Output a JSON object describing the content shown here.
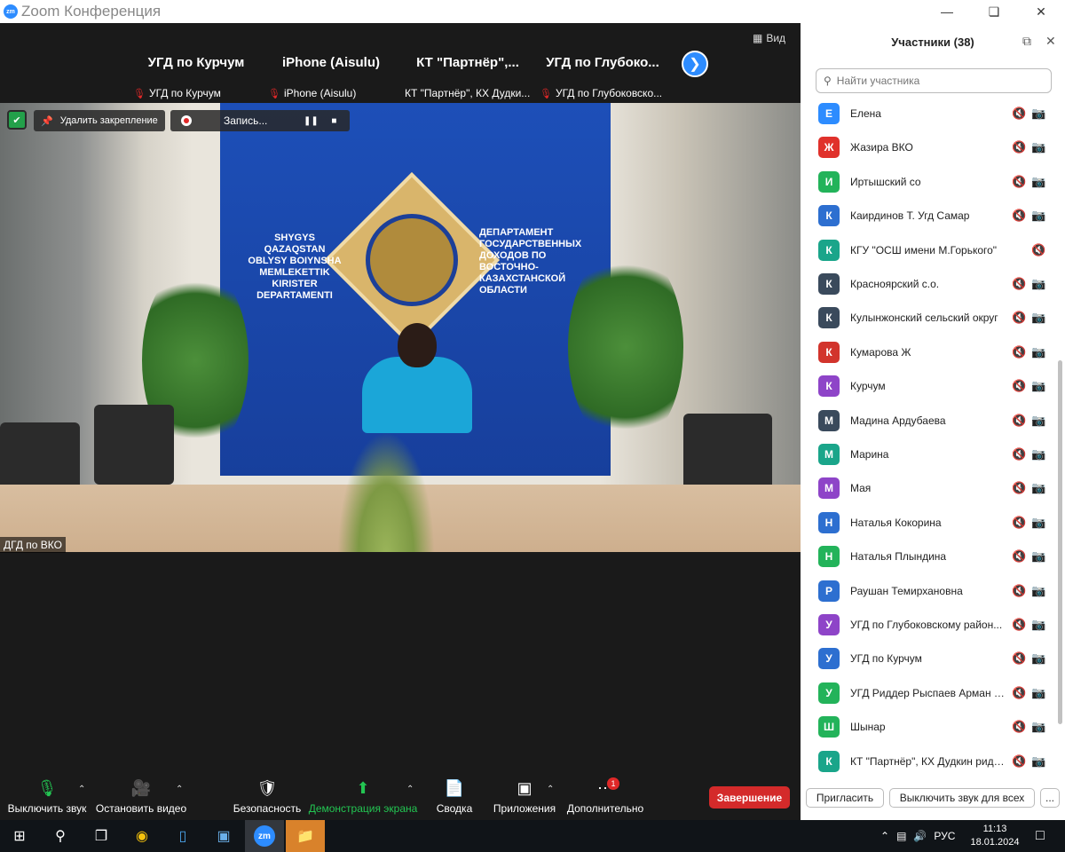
{
  "window": {
    "title": "Zoom Конференция",
    "logo": "zm"
  },
  "thumbnails": [
    {
      "name": "УГД по Курчум",
      "label": "УГД по Курчум"
    },
    {
      "name": "iPhone (Aisulu)",
      "label": "iPhone (Aisulu)"
    },
    {
      "name": "КТ  \"Партнёр\",...",
      "label": "КТ \"Партнёр\", КХ Дудки..."
    },
    {
      "name": "УГД  по  Глубоко...",
      "label": "УГД по Глубоковско..."
    }
  ],
  "view_label": "Вид",
  "video": {
    "unpin_label": "Удалить закрепление",
    "recording_label": "Запись...",
    "speaker_name": "ДГД по ВКО",
    "wall_left": "SHYGYS QAZAQSTAN\nOBLYSY BOIYNSHA\nMEMLEKETTIK\nKIRISTER\nDEPARTAMENTI",
    "wall_right": "ДЕПАРТАМЕНТ\nГОСУДАРСТВЕННЫХ\nДОХОДОВ ПО\nВОСТОЧНО-КАЗАХСТАНСКОЙ\nОБЛАСТИ"
  },
  "toolbar": {
    "mute_label": "Выключить звук",
    "video_label": "Остановить видео",
    "security_label": "Безопасность",
    "share_label": "Демонстрация экрана",
    "summary_label": "Сводка",
    "apps_label": "Приложения",
    "more_label": "Дополнительно",
    "more_badge": "1",
    "end_label": "Завершение"
  },
  "panel": {
    "title": "Участники (38)",
    "search_placeholder": "Найти участника",
    "participants": [
      {
        "initial": "Е",
        "name": "Елена",
        "color": "#2d8cff",
        "cam_off": true
      },
      {
        "initial": "Ж",
        "name": "Жазира ВКО",
        "color": "#e0312b",
        "cam_off": true
      },
      {
        "initial": "И",
        "name": "Иртышский со",
        "color": "#23b35a",
        "cam_off": true
      },
      {
        "initial": "К",
        "name": "Каирдинов Т. Угд Самар",
        "color": "#2d6fd0",
        "cam_off": true
      },
      {
        "initial": "К",
        "name": "КГУ \"ОСШ имени М.Горького\"",
        "color": "#1aa58a",
        "cam_off": false
      },
      {
        "initial": "К",
        "name": "Красноярский с.о.",
        "color": "#3a4a5c",
        "cam_off": true
      },
      {
        "initial": "К",
        "name": "Кулынжонский сельский округ",
        "color": "#3a4a5c",
        "cam_off": true
      },
      {
        "initial": "К",
        "name": "Кумарова Ж",
        "color": "#d2342c",
        "cam_off": true
      },
      {
        "initial": "К",
        "name": "Курчум",
        "color": "#8e44c8",
        "cam_off": true
      },
      {
        "initial": "М",
        "name": "Мадина Ардубаева",
        "color": "#3a4a5c",
        "cam_off": true
      },
      {
        "initial": "М",
        "name": "Марина",
        "color": "#1aa58a",
        "cam_off": true
      },
      {
        "initial": "М",
        "name": "Мая",
        "color": "#8e44c8",
        "cam_off": true
      },
      {
        "initial": "Н",
        "name": "Наталья Кокорина",
        "color": "#2d6fd0",
        "cam_off": true
      },
      {
        "initial": "Н",
        "name": "Наталья Плындина",
        "color": "#23b35a",
        "cam_off": true
      },
      {
        "initial": "Р",
        "name": "Раушан Темирхановна",
        "color": "#2d6fd0",
        "cam_off": true
      },
      {
        "initial": "У",
        "name": "УГД по Глубоковскому район...",
        "color": "#8e44c8",
        "cam_off": true
      },
      {
        "initial": "У",
        "name": "УГД по Курчум",
        "color": "#2d6fd0",
        "cam_off": true
      },
      {
        "initial": "У",
        "name": "УГД Риддер Рыспаев Арман Б...",
        "color": "#23b35a",
        "cam_off": true
      },
      {
        "initial": "Ш",
        "name": "Шынар",
        "color": "#23b35a",
        "cam_off": true
      },
      {
        "initial": "К",
        "name": "КТ \"Партнёр\", КХ Дудкин риддер",
        "color": "#1aa58a",
        "cam_off": true
      }
    ],
    "invite_label": "Пригласить",
    "mute_all_label": "Выключить звук для всех",
    "more_label": "..."
  },
  "taskbar": {
    "lang": "РУС",
    "time": "11:13",
    "date": "18.01.2024"
  }
}
